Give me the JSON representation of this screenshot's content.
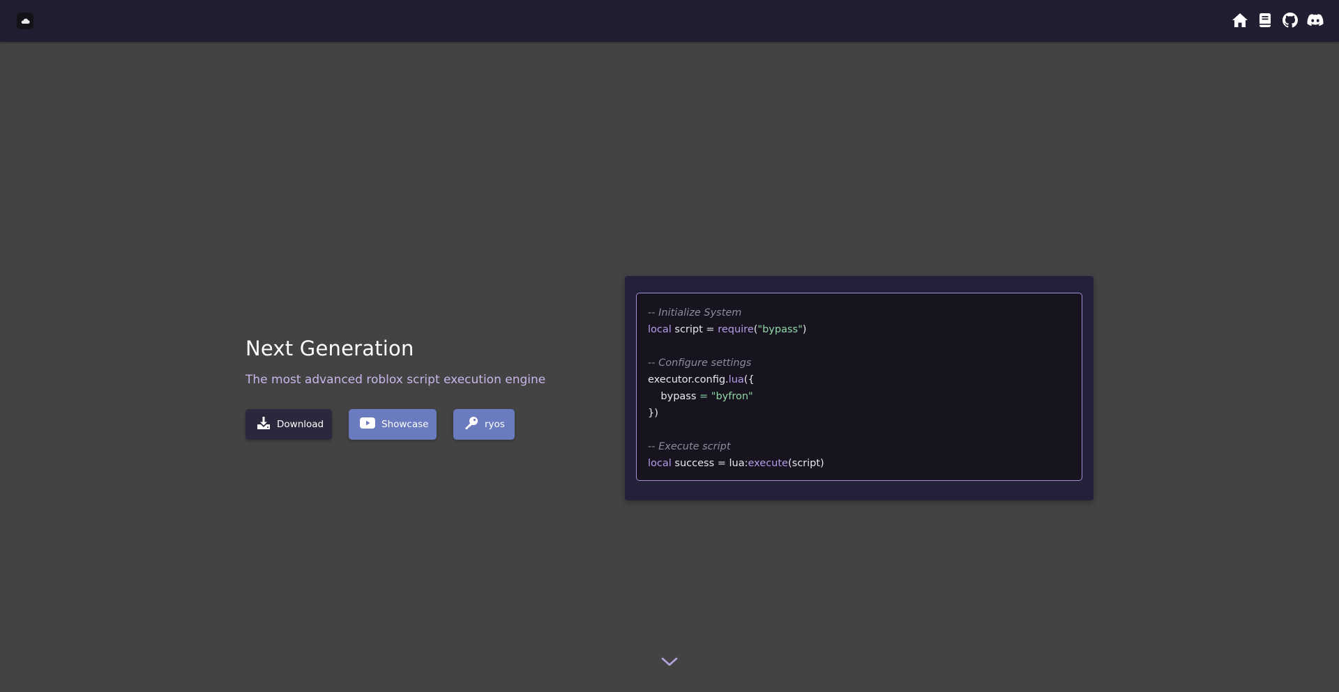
{
  "navbar": {
    "logo_icon": "cloud-logo-icon",
    "icons": [
      "home-icon",
      "book-icon",
      "github-icon",
      "discord-icon"
    ]
  },
  "hero": {
    "title": "Next Generation",
    "subtitle": "The most advanced roblox script execution engine",
    "buttons": [
      {
        "label": "Download",
        "icon": "download-icon"
      },
      {
        "label": "Showcase",
        "icon": "youtube-icon"
      },
      {
        "label": "ryos",
        "icon": "key-icon"
      }
    ]
  },
  "code": {
    "line1": "-- Initialize System",
    "line2": {
      "kw": "local",
      "var": " script = ",
      "fn": "require",
      "open": "(",
      "str": "\"bypass\"",
      "close": ")"
    },
    "line4": "-- Configure settings",
    "line5": {
      "obj": "executor.config.",
      "fn": "lua",
      "rest": "({"
    },
    "line6": {
      "key": "    bypass ",
      "op": "=",
      "str": " \"byfron\""
    },
    "line7": "})",
    "line9": "-- Execute script",
    "line10": {
      "kw": "local",
      "var": " success = lua:",
      "fn": "execute",
      "rest": "(script)"
    }
  },
  "colors": {
    "background": "#434343",
    "navbar": "#201e30",
    "accent_purple": "#b79ce8",
    "button_blue": "#6a7bbf",
    "button_dark": "#2a283c"
  },
  "scroll_indicator_icon": "chevron-down-icon"
}
